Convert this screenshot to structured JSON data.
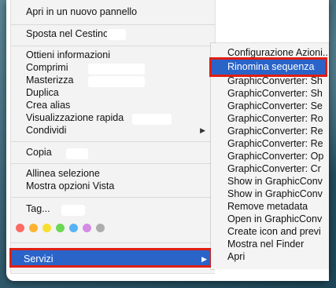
{
  "left_menu": {
    "items": [
      {
        "label": "Apri in un nuovo pannello"
      },
      {
        "label": "Sposta nel Cestino"
      },
      {
        "label": "Ottieni informazioni"
      },
      {
        "label": "Comprimi"
      },
      {
        "label": "Masterizza"
      },
      {
        "label": "Duplica"
      },
      {
        "label": "Crea alias"
      },
      {
        "label": "Visualizzazione rapida"
      },
      {
        "label": "Condividi"
      },
      {
        "label": "Copia"
      },
      {
        "label": "Allinea selezione"
      },
      {
        "label": "Mostra opzioni Vista"
      },
      {
        "label": "Tag..."
      }
    ],
    "tag_colors": [
      "#fb6b62",
      "#fdb231",
      "#f7df2f",
      "#6bd752",
      "#56b4f5",
      "#d58be6",
      "#adadad"
    ],
    "servizi_label": "Servizi",
    "submenu_arrow": "▶"
  },
  "right_menu": {
    "items": [
      {
        "label": "Configurazione Azioni..."
      },
      {
        "label": "Rinomina sequenza"
      },
      {
        "label": "GraphicConverter: Sh"
      },
      {
        "label": "GraphicConverter: Sh"
      },
      {
        "label": "GraphicConverter: Se"
      },
      {
        "label": "GraphicConverter: Ro"
      },
      {
        "label": "GraphicConverter: Re"
      },
      {
        "label": "GraphicConverter: Re"
      },
      {
        "label": "GraphicConverter: Op"
      },
      {
        "label": "GraphicConverter: Cr"
      },
      {
        "label": "Show in GraphicConv"
      },
      {
        "label": "Show in GraphicConv"
      },
      {
        "label": "Remove metadata"
      },
      {
        "label": "Open in GraphicConv"
      },
      {
        "label": "Create icon and previ"
      },
      {
        "label": "Mostra nel Finder"
      },
      {
        "label": "Apri"
      }
    ]
  },
  "colors": {
    "highlight": "#2a64c9",
    "annotation_red": "#e01e13"
  }
}
